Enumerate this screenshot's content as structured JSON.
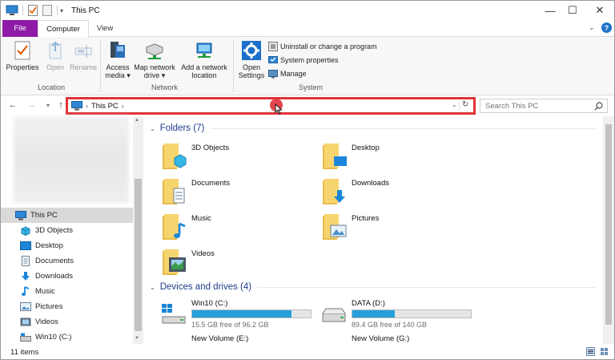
{
  "window": {
    "title": "This PC"
  },
  "tabs": {
    "file": "File",
    "computer": "Computer",
    "view": "View"
  },
  "ribbon": {
    "location": {
      "label": "Location",
      "properties": "Properties",
      "open": "Open",
      "rename": "Rename"
    },
    "network": {
      "label": "Network",
      "access_media_1": "Access",
      "access_media_2": "media ▾",
      "map_drive_1": "Map network",
      "map_drive_2": "drive ▾",
      "add_location_1": "Add a network",
      "add_location_2": "location"
    },
    "system": {
      "label": "System",
      "open_settings_1": "Open",
      "open_settings_2": "Settings",
      "uninstall": "Uninstall or change a program",
      "system_properties": "System properties",
      "manage": "Manage"
    }
  },
  "address": {
    "path": "This PC"
  },
  "search": {
    "placeholder": "Search This PC"
  },
  "sidebar": {
    "items": [
      {
        "label": "This PC",
        "icon": "pc-icon"
      },
      {
        "label": "3D Objects",
        "icon": "cube-icon"
      },
      {
        "label": "Desktop",
        "icon": "desktop-icon"
      },
      {
        "label": "Documents",
        "icon": "documents-icon"
      },
      {
        "label": "Downloads",
        "icon": "download-icon"
      },
      {
        "label": "Music",
        "icon": "music-icon"
      },
      {
        "label": "Pictures",
        "icon": "pictures-icon"
      },
      {
        "label": "Videos",
        "icon": "videos-icon"
      },
      {
        "label": "Win10 (C:)",
        "icon": "drive-icon"
      }
    ]
  },
  "folders": {
    "header": "Folders (7)",
    "items": [
      "3D Objects",
      "Desktop",
      "Documents",
      "Downloads",
      "Music",
      "Pictures",
      "Videos"
    ]
  },
  "devices": {
    "header": "Devices and drives (4)",
    "drives": [
      {
        "name": "Win10 (C:)",
        "free": "15.5 GB free of 96.2 GB",
        "used_fraction": 0.84
      },
      {
        "name": "DATA (D:)",
        "free": "89.4 GB free of 140 GB",
        "used_fraction": 0.36
      }
    ],
    "volumes": [
      "New Volume (E:)",
      "New Volume (G:)"
    ]
  },
  "status": {
    "count": "11 items"
  },
  "colors": {
    "file_tab": "#8e1aa6",
    "highlight": "#e0333a",
    "drive_bar": "#26a0da",
    "group_header": "#1e3c8c"
  }
}
